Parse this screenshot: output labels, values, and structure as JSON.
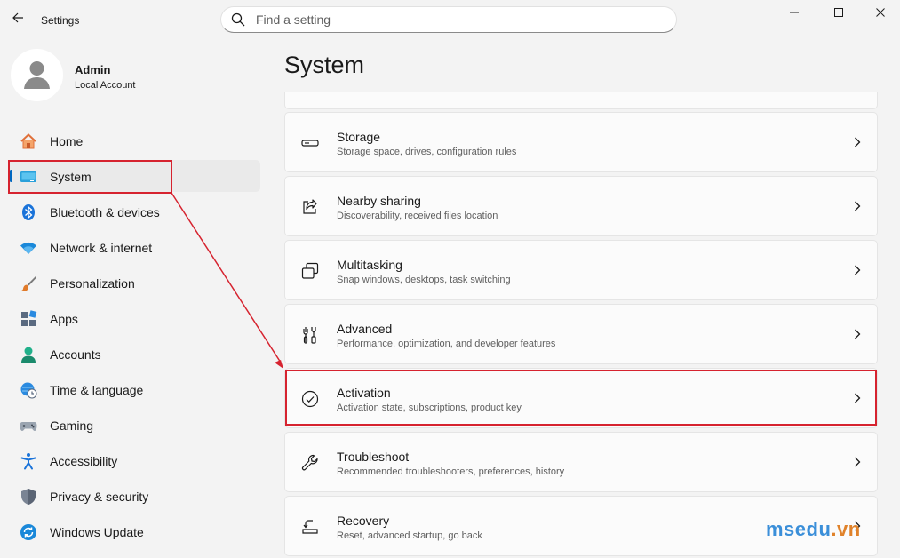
{
  "window": {
    "title": "Settings",
    "controls": [
      "minimize",
      "maximize",
      "close"
    ]
  },
  "search": {
    "placeholder": "Find a setting"
  },
  "profile": {
    "name": "Admin",
    "account_type": "Local Account"
  },
  "sidebar": {
    "items": [
      {
        "label": "Home",
        "icon": "home-icon",
        "selected": false
      },
      {
        "label": "System",
        "icon": "system-monitor-icon",
        "selected": true
      },
      {
        "label": "Bluetooth & devices",
        "icon": "bluetooth-icon",
        "selected": false
      },
      {
        "label": "Network & internet",
        "icon": "wifi-icon",
        "selected": false
      },
      {
        "label": "Personalization",
        "icon": "brush-icon",
        "selected": false
      },
      {
        "label": "Apps",
        "icon": "apps-icon",
        "selected": false
      },
      {
        "label": "Accounts",
        "icon": "accounts-icon",
        "selected": false
      },
      {
        "label": "Time & language",
        "icon": "globe-clock-icon",
        "selected": false
      },
      {
        "label": "Gaming",
        "icon": "gamepad-icon",
        "selected": false
      },
      {
        "label": "Accessibility",
        "icon": "accessibility-icon",
        "selected": false
      },
      {
        "label": "Privacy & security",
        "icon": "shield-icon",
        "selected": false
      },
      {
        "label": "Windows Update",
        "icon": "update-icon",
        "selected": false
      }
    ]
  },
  "main": {
    "title": "System",
    "cards": [
      {
        "title": "Storage",
        "subtitle": "Storage space, drives, configuration rules",
        "icon": "storage-icon"
      },
      {
        "title": "Nearby sharing",
        "subtitle": "Discoverability, received files location",
        "icon": "share-icon"
      },
      {
        "title": "Multitasking",
        "subtitle": "Snap windows, desktops, task switching",
        "icon": "multitasking-icon"
      },
      {
        "title": "Advanced",
        "subtitle": "Performance, optimization, and developer features",
        "icon": "advanced-tools-icon"
      },
      {
        "title": "Activation",
        "subtitle": "Activation state, subscriptions, product key",
        "icon": "check-circle-icon"
      },
      {
        "title": "Troubleshoot",
        "subtitle": "Recommended troubleshooters, preferences, history",
        "icon": "wrench-icon"
      },
      {
        "title": "Recovery",
        "subtitle": "Reset, advanced startup, go back",
        "icon": "recovery-icon"
      }
    ]
  },
  "annotation": {
    "highlight_color": "#d6232f",
    "highlighted": [
      "System",
      "Activation"
    ]
  },
  "watermark": {
    "part1": "msedu",
    "part2": ".vn"
  },
  "colors": {
    "accent": "#0067c0",
    "background": "#f3f3f3",
    "card": "#fbfbfb"
  }
}
